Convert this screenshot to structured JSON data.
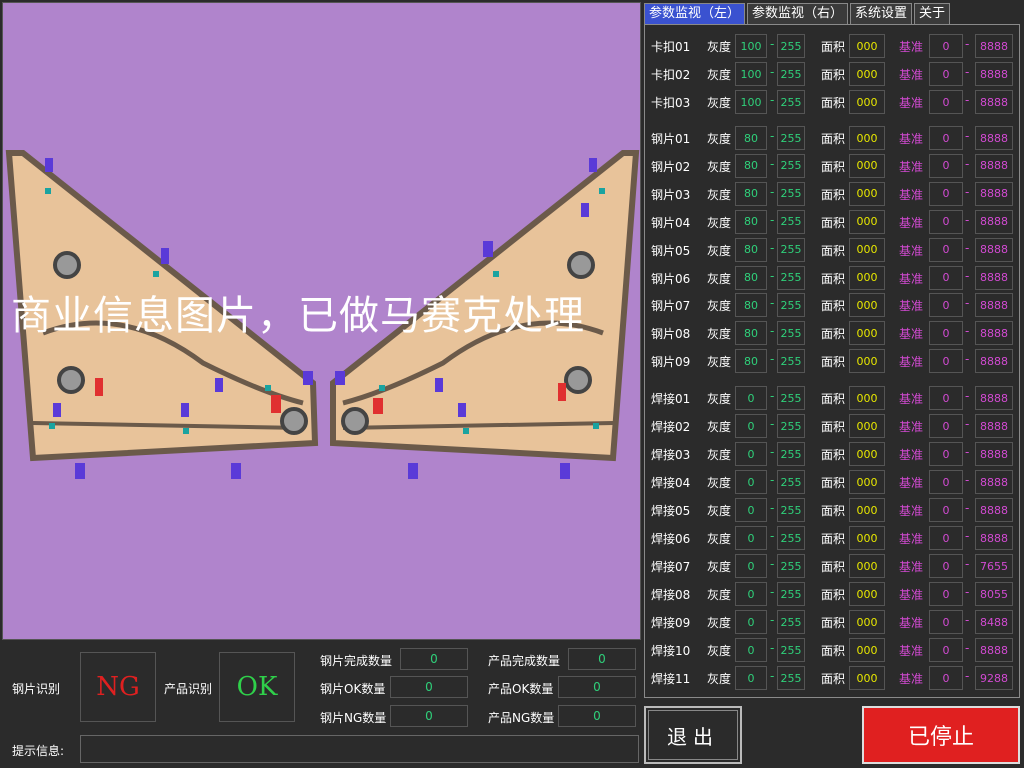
{
  "camera": {
    "watermark": "商业信息图片，已做马赛克处理",
    "colors": {
      "background": "#b084cc",
      "part": "#e8c39a",
      "outline": "#6b5a4a",
      "marker_teal": "#1aa3a0",
      "marker_blue": "#5a3ad8",
      "marker_red": "#e03030"
    }
  },
  "tabs": [
    {
      "label": "参数监视（左）",
      "active": true
    },
    {
      "label": "参数监视（右）",
      "active": false
    },
    {
      "label": "系统设置",
      "active": false
    },
    {
      "label": "关于",
      "active": false
    }
  ],
  "param_labels": {
    "gray": "灰度",
    "area": "面积",
    "ref": "基准",
    "dash": "-"
  },
  "params": [
    {
      "name": "卡扣01",
      "gray_min": "100",
      "gray_max": "255",
      "area": "000",
      "ref_min": "0",
      "ref_max": "8888"
    },
    {
      "name": "卡扣02",
      "gray_min": "100",
      "gray_max": "255",
      "area": "000",
      "ref_min": "0",
      "ref_max": "8888"
    },
    {
      "name": "卡扣03",
      "gray_min": "100",
      "gray_max": "255",
      "area": "000",
      "ref_min": "0",
      "ref_max": "8888"
    },
    {
      "name": "钢片01",
      "gray_min": "80",
      "gray_max": "255",
      "area": "000",
      "ref_min": "0",
      "ref_max": "8888"
    },
    {
      "name": "钢片02",
      "gray_min": "80",
      "gray_max": "255",
      "area": "000",
      "ref_min": "0",
      "ref_max": "8888"
    },
    {
      "name": "钢片03",
      "gray_min": "80",
      "gray_max": "255",
      "area": "000",
      "ref_min": "0",
      "ref_max": "8888"
    },
    {
      "name": "钢片04",
      "gray_min": "80",
      "gray_max": "255",
      "area": "000",
      "ref_min": "0",
      "ref_max": "8888"
    },
    {
      "name": "钢片05",
      "gray_min": "80",
      "gray_max": "255",
      "area": "000",
      "ref_min": "0",
      "ref_max": "8888"
    },
    {
      "name": "钢片06",
      "gray_min": "80",
      "gray_max": "255",
      "area": "000",
      "ref_min": "0",
      "ref_max": "8888"
    },
    {
      "name": "钢片07",
      "gray_min": "80",
      "gray_max": "255",
      "area": "000",
      "ref_min": "0",
      "ref_max": "8888"
    },
    {
      "name": "钢片08",
      "gray_min": "80",
      "gray_max": "255",
      "area": "000",
      "ref_min": "0",
      "ref_max": "8888"
    },
    {
      "name": "钢片09",
      "gray_min": "80",
      "gray_max": "255",
      "area": "000",
      "ref_min": "0",
      "ref_max": "8888"
    },
    {
      "name": "焊接01",
      "gray_min": "0",
      "gray_max": "255",
      "area": "000",
      "ref_min": "0",
      "ref_max": "8888"
    },
    {
      "name": "焊接02",
      "gray_min": "0",
      "gray_max": "255",
      "area": "000",
      "ref_min": "0",
      "ref_max": "8888"
    },
    {
      "name": "焊接03",
      "gray_min": "0",
      "gray_max": "255",
      "area": "000",
      "ref_min": "0",
      "ref_max": "8888"
    },
    {
      "name": "焊接04",
      "gray_min": "0",
      "gray_max": "255",
      "area": "000",
      "ref_min": "0",
      "ref_max": "8888"
    },
    {
      "name": "焊接05",
      "gray_min": "0",
      "gray_max": "255",
      "area": "000",
      "ref_min": "0",
      "ref_max": "8888"
    },
    {
      "name": "焊接06",
      "gray_min": "0",
      "gray_max": "255",
      "area": "000",
      "ref_min": "0",
      "ref_max": "8888"
    },
    {
      "name": "焊接07",
      "gray_min": "0",
      "gray_max": "255",
      "area": "000",
      "ref_min": "0",
      "ref_max": "7655"
    },
    {
      "name": "焊接08",
      "gray_min": "0",
      "gray_max": "255",
      "area": "000",
      "ref_min": "0",
      "ref_max": "8055"
    },
    {
      "name": "焊接09",
      "gray_min": "0",
      "gray_max": "255",
      "area": "000",
      "ref_min": "0",
      "ref_max": "8488"
    },
    {
      "name": "焊接10",
      "gray_min": "0",
      "gray_max": "255",
      "area": "000",
      "ref_min": "0",
      "ref_max": "8888"
    },
    {
      "name": "焊接11",
      "gray_min": "0",
      "gray_max": "255",
      "area": "000",
      "ref_min": "0",
      "ref_max": "9288"
    }
  ],
  "recognition": {
    "steel_label": "钢片识别",
    "steel_result": "NG",
    "product_label": "产品识别",
    "product_result": "OK",
    "ng_color": "#e02020",
    "ok_color": "#2fd04a"
  },
  "counters": {
    "steel_done_label": "钢片完成数量",
    "steel_done": "0",
    "steel_ok_label": "钢片OK数量",
    "steel_ok": "0",
    "steel_ng_label": "钢片NG数量",
    "steel_ng": "0",
    "prod_done_label": "产品完成数量",
    "prod_done": "0",
    "prod_ok_label": "产品OK数量",
    "prod_ok": "0",
    "prod_ng_label": "产品NG数量",
    "prod_ng": "0"
  },
  "hint": {
    "label": "提示信息:",
    "value": ""
  },
  "buttons": {
    "exit": "退出",
    "status": "已停止"
  }
}
